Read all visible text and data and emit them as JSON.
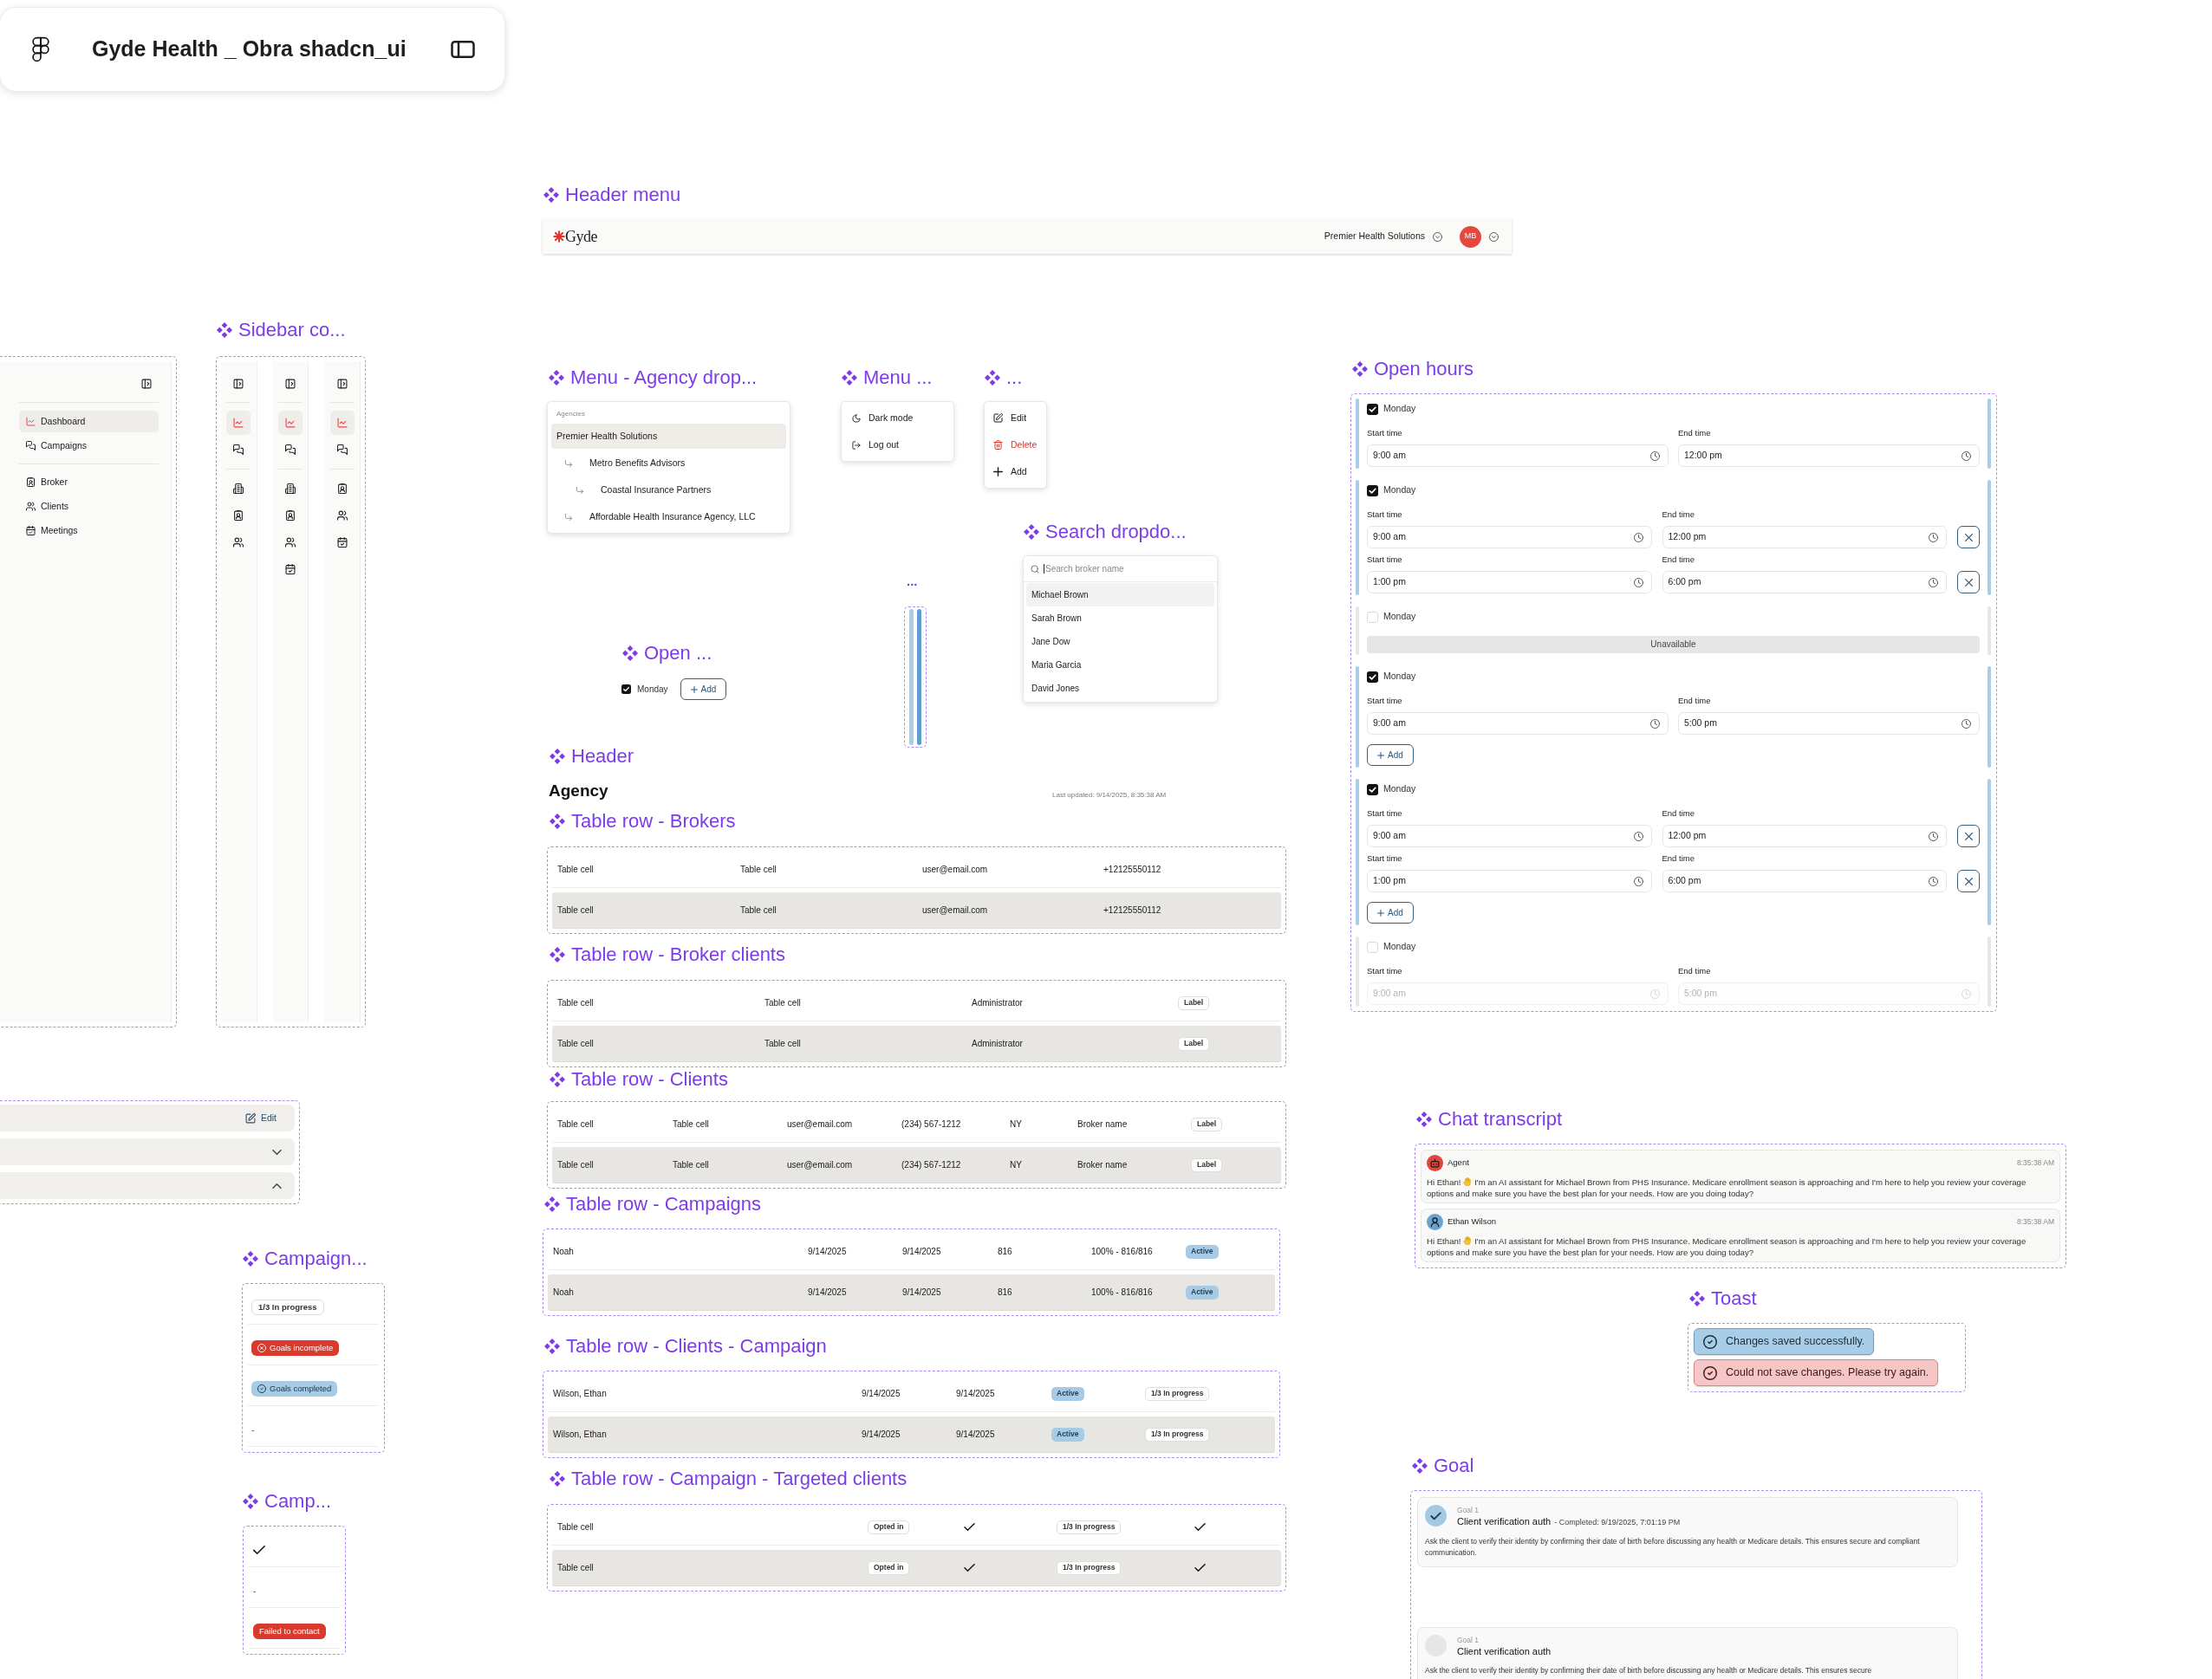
{
  "file_bar": {
    "title": "Gyde Health _ Obra shadcn_ui"
  },
  "header_menu": {
    "title": "Header menu",
    "logo": "Gyde",
    "account": "Premier Health Solutions",
    "avatar": "MB"
  },
  "sidebar_component": {
    "title": "Sidebar co...",
    "expanded": {
      "groups": [
        {
          "items": [
            {
              "label": "Dashboard",
              "selected": true
            },
            {
              "label": "Campaigns",
              "selected": false
            }
          ]
        },
        {
          "items": [
            {
              "label": "Broker",
              "selected": false
            },
            {
              "label": "Clients",
              "selected": false
            },
            {
              "label": "Meetings",
              "selected": false
            }
          ]
        }
      ]
    },
    "rails": [
      {
        "groups": [
          {
            "items": [
              {
                "selected": true
              },
              {
                "selected": false
              }
            ]
          },
          {
            "items": [
              {
                "selected": false
              },
              {
                "selected": false
              },
              {
                "selected": false
              }
            ]
          }
        ]
      },
      {
        "groups": [
          {
            "items": [
              {
                "selected": true
              },
              {
                "selected": false
              }
            ]
          },
          {
            "items": [
              {
                "selected": false
              },
              {
                "selected": false
              },
              {
                "selected": false
              },
              {
                "selected": false
              }
            ]
          }
        ]
      },
      {
        "groups": [
          {
            "items": [
              {
                "selected": true
              },
              {
                "selected": false
              }
            ]
          },
          {
            "items": [
              {
                "selected": false
              },
              {
                "selected": false
              },
              {
                "selected": false
              }
            ]
          }
        ]
      }
    ]
  },
  "agency_menu": {
    "title": "Menu - Agency drop...",
    "heading": "Agencies",
    "items": [
      {
        "label": "Premier Health Solutions",
        "selected": true,
        "children": [
          {
            "label": "Metro Benefits Advisors",
            "selected": false,
            "children": [
              {
                "label": "Coastal Insurance Partners",
                "selected": false
              }
            ]
          },
          {
            "label": "Affordable Health Insurance Agency, LLC",
            "selected": false
          }
        ]
      }
    ]
  },
  "user_menu": {
    "title": "Menu ...",
    "items": [
      {
        "kind": "dark_mode",
        "label": "Dark mode"
      },
      {
        "kind": "log_out",
        "label": "Log out"
      }
    ]
  },
  "row_menu": {
    "title": "...",
    "items": [
      {
        "kind": "edit",
        "label": "Edit"
      },
      {
        "kind": "delete",
        "label": "Delete"
      },
      {
        "kind": "add",
        "label": "Add"
      }
    ]
  },
  "open_hours": {
    "title": "Open hours",
    "days": [
      {
        "label": "Monday",
        "checked": true,
        "kind": "hours",
        "disabled": false,
        "removable": false,
        "ranges": [
          {
            "start_label": "Start time",
            "start": "9:00 am",
            "end_label": "End time",
            "end": "12:00 pm"
          }
        ]
      },
      {
        "label": "Monday",
        "checked": true,
        "kind": "hours",
        "disabled": false,
        "removable": true,
        "ranges": [
          {
            "start_label": "Start time",
            "start": "9:00 am",
            "end_label": "End time",
            "end": "12:00 pm"
          },
          {
            "start_label": "Start time",
            "start": "1:00 pm",
            "end_label": "End time",
            "end": "6:00 pm"
          }
        ]
      },
      {
        "label": "Monday",
        "checked": false,
        "kind": "unavailable",
        "text": "Unavailable"
      },
      {
        "label": "Monday",
        "checked": true,
        "kind": "hours",
        "disabled": false,
        "removable": false,
        "ranges": [
          {
            "start_label": "Start time",
            "start": "9:00 am",
            "end_label": "End time",
            "end": "5:00 pm"
          }
        ],
        "add": "Add"
      },
      {
        "label": "Monday",
        "checked": true,
        "kind": "hours",
        "disabled": false,
        "removable": true,
        "ranges": [
          {
            "start_label": "Start time",
            "start": "9:00 am",
            "end_label": "End time",
            "end": "12:00 pm"
          },
          {
            "start_label": "Start time",
            "start": "1:00 pm",
            "end_label": "End time",
            "end": "6:00 pm"
          }
        ],
        "add": "Add"
      },
      {
        "label": "Monday",
        "checked": false,
        "kind": "hours",
        "disabled": true,
        "removable": false,
        "ranges": [
          {
            "start_label": "Start time",
            "start": "9:00 am",
            "end_label": "End time",
            "end": "5:00 pm"
          }
        ]
      }
    ]
  },
  "search_dropdown": {
    "title": "Search dropdo...",
    "placeholder": "Search broker name",
    "focused": true,
    "options": [
      {
        "label": "Michael Brown",
        "selected": true
      },
      {
        "label": "Sarah Brown",
        "selected": false
      },
      {
        "label": "Jane Dow",
        "selected": false
      },
      {
        "label": "Maria Garcia",
        "selected": false
      },
      {
        "label": "David Jones",
        "selected": false
      }
    ]
  },
  "open_day_component": {
    "title": "Open ...",
    "day": "Monday",
    "checked": true,
    "add": "Add"
  },
  "scrollbar_component": {
    "title": "..."
  },
  "header_component": {
    "title": "Header",
    "heading": "Agency",
    "updated": "Last updated: 9/14/2025, 8:35:38 AM"
  },
  "table_rows": [
    {
      "title": "Table row - Brokers",
      "rows": [
        {
          "highlighted": false,
          "cells": [
            {
              "kind": "text",
              "text": "Table cell"
            },
            {
              "kind": "text",
              "text": "Table cell"
            },
            {
              "kind": "text",
              "text": "user@email.com"
            },
            {
              "kind": "text",
              "text": "+12125550112"
            }
          ]
        },
        {
          "highlighted": true,
          "cells": [
            {
              "kind": "text",
              "text": "Table cell"
            },
            {
              "kind": "text",
              "text": "Table cell"
            },
            {
              "kind": "text",
              "text": "user@email.com"
            },
            {
              "kind": "text",
              "text": "+12125550112"
            }
          ]
        }
      ]
    },
    {
      "title": "Table row - Broker clients",
      "rows": [
        {
          "highlighted": false,
          "cells": [
            {
              "kind": "text",
              "text": "Table cell"
            },
            {
              "kind": "text",
              "text": "Table cell"
            },
            {
              "kind": "text",
              "text": "Administrator"
            },
            {
              "kind": "outline_badge",
              "text": "Label"
            }
          ]
        },
        {
          "highlighted": true,
          "cells": [
            {
              "kind": "text",
              "text": "Table cell"
            },
            {
              "kind": "text",
              "text": "Table cell"
            },
            {
              "kind": "text",
              "text": "Administrator"
            },
            {
              "kind": "outline_badge",
              "text": "Label"
            }
          ]
        }
      ]
    },
    {
      "title": "Table row - Clients",
      "rows": [
        {
          "highlighted": false,
          "cells": [
            {
              "kind": "text",
              "text": "Table cell"
            },
            {
              "kind": "text",
              "text": "Table cell"
            },
            {
              "kind": "text",
              "text": "user@email.com"
            },
            {
              "kind": "text",
              "text": "(234) 567-1212"
            },
            {
              "kind": "text",
              "text": "NY"
            },
            {
              "kind": "text",
              "text": "Broker name"
            },
            {
              "kind": "outline_badge",
              "text": "Label"
            }
          ]
        },
        {
          "highlighted": true,
          "cells": [
            {
              "kind": "text",
              "text": "Table cell"
            },
            {
              "kind": "text",
              "text": "Table cell"
            },
            {
              "kind": "text",
              "text": "user@email.com"
            },
            {
              "kind": "text",
              "text": "(234) 567-1212"
            },
            {
              "kind": "text",
              "text": "NY"
            },
            {
              "kind": "text",
              "text": "Broker name"
            },
            {
              "kind": "outline_badge",
              "text": "Label"
            }
          ]
        }
      ]
    },
    {
      "title": "Table row - Campaigns",
      "rows": [
        {
          "highlighted": false,
          "cells": [
            {
              "kind": "text",
              "text": "Noah"
            },
            {
              "kind": "text",
              "text": "9/14/2025"
            },
            {
              "kind": "text",
              "text": "9/14/2025"
            },
            {
              "kind": "text",
              "text": "816"
            },
            {
              "kind": "text",
              "text": "100% - 816/816"
            },
            {
              "kind": "status_badge",
              "text": "Active"
            }
          ]
        },
        {
          "highlighted": true,
          "cells": [
            {
              "kind": "text",
              "text": "Noah"
            },
            {
              "kind": "text",
              "text": "9/14/2025"
            },
            {
              "kind": "text",
              "text": "9/14/2025"
            },
            {
              "kind": "text",
              "text": "816"
            },
            {
              "kind": "text",
              "text": "100% - 816/816"
            },
            {
              "kind": "status_badge",
              "text": "Active"
            }
          ]
        }
      ]
    },
    {
      "title": "Table row - Clients - Campaign",
      "rows": [
        {
          "highlighted": false,
          "cells": [
            {
              "kind": "text",
              "text": "Wilson, Ethan"
            },
            {
              "kind": "text",
              "text": "9/14/2025"
            },
            {
              "kind": "text",
              "text": "9/14/2025"
            },
            {
              "kind": "status_badge",
              "text": "Active"
            },
            {
              "kind": "outline_badge",
              "text": "1/3 In progress"
            }
          ]
        },
        {
          "highlighted": true,
          "cells": [
            {
              "kind": "text",
              "text": "Wilson, Ethan"
            },
            {
              "kind": "text",
              "text": "9/14/2025"
            },
            {
              "kind": "text",
              "text": "9/14/2025"
            },
            {
              "kind": "status_badge",
              "text": "Active"
            },
            {
              "kind": "outline_badge",
              "text": "1/3 In progress"
            }
          ]
        }
      ]
    },
    {
      "title": "Table row - Campaign - Targeted clients",
      "rows": [
        {
          "highlighted": false,
          "cells": [
            {
              "kind": "text",
              "text": "Table cell"
            },
            {
              "kind": "outline_badge",
              "text": "Opted in"
            },
            {
              "kind": "check"
            },
            {
              "kind": "outline_badge",
              "text": "1/3 In progress"
            },
            {
              "kind": "check"
            }
          ]
        },
        {
          "highlighted": true,
          "cells": [
            {
              "kind": "text",
              "text": "Table cell"
            },
            {
              "kind": "outline_badge",
              "text": "Opted in"
            },
            {
              "kind": "check"
            },
            {
              "kind": "outline_badge",
              "text": "1/3 In progress"
            },
            {
              "kind": "check"
            }
          ]
        }
      ]
    }
  ],
  "accordion_rows": [
    {
      "kind": "action",
      "label": "Edit"
    },
    {
      "kind": "toggle",
      "expanded": false
    },
    {
      "kind": "toggle",
      "expanded": true
    }
  ],
  "campaign_status_component": {
    "title": "Campaign...",
    "cells": [
      {
        "kind": "outline_badge",
        "text": "1/3 In progress"
      },
      {
        "kind": "danger_icon_badge",
        "text": "Goals incomplete"
      },
      {
        "kind": "success_icon_badge",
        "text": "Goals completed"
      },
      {
        "kind": "text",
        "text": "-"
      }
    ]
  },
  "campaign_contact_component": {
    "title": "Camp...",
    "cells": [
      {
        "kind": "check"
      },
      {
        "kind": "text",
        "text": "-"
      },
      {
        "kind": "danger_badge",
        "text": "Failed to contact"
      }
    ]
  },
  "chat_transcript": {
    "title": "Chat transcript",
    "messages": [
      {
        "kind": "agent",
        "sender": "Agent",
        "time": "8:35:38 AM",
        "greeting": "Hi Ethan!",
        "text": "I'm an AI assistant for Michael Brown from PHS Insurance. Medicare enrollment season is approaching and I'm here to help you review your coverage options and make sure you have the best plan for your needs. How are you doing today?"
      },
      {
        "kind": "user",
        "sender": "Ethan Wilson",
        "time": "8:35:38 AM",
        "greeting": "Hi Ethan!",
        "text": "I'm an AI assistant for Michael Brown from PHS Insurance. Medicare enrollment season is approaching and I'm here to help you review your coverage options and make sure you have the best plan for your needs. How are you doing today?"
      }
    ]
  },
  "toast": {
    "title": "Toast",
    "toasts": [
      {
        "kind": "success",
        "text": "Changes saved successfully."
      },
      {
        "kind": "error",
        "text": "Could not save changes. Please try again."
      }
    ]
  },
  "goal": {
    "title": "Goal",
    "goals": [
      {
        "completed": true,
        "number": "Goal 1",
        "name": "Client verification auth",
        "detail": "- Completed: 9/19/2025, 7:01:19 PM",
        "description": "Ask the client to verify their identity by confirming their date of birth before discussing any health or Medicare details. This ensures secure and compliant communication."
      },
      {
        "completed": false,
        "number": "Goal 1",
        "name": "Client verification auth",
        "description": "Ask the client to verify their identity by confirming their date of birth before discussing any health or Medicare details. This ensures secure"
      }
    ]
  }
}
